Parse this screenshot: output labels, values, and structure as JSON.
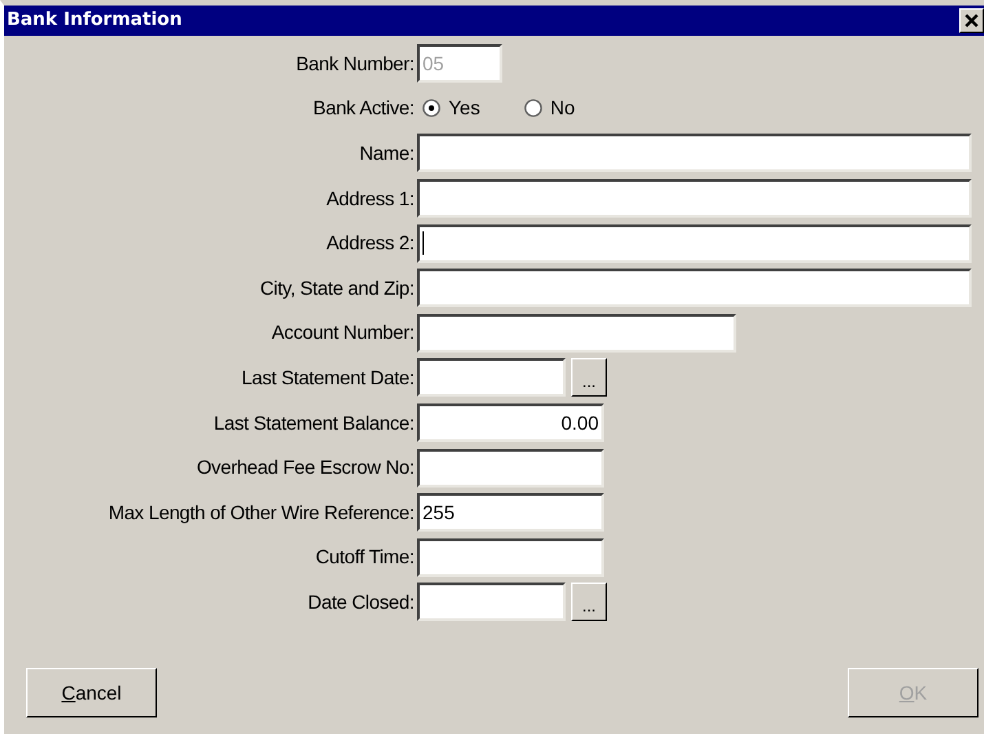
{
  "window": {
    "title": "Bank Information"
  },
  "fields": [
    {
      "kind": "tinytext",
      "label": "Bank Number:",
      "value": "05",
      "disabled": true
    },
    {
      "kind": "radio",
      "label": "Bank Active:",
      "options": [
        {
          "label": "Yes",
          "selected": true
        },
        {
          "label": "No",
          "selected": false
        }
      ]
    },
    {
      "kind": "longtext",
      "label": "Name:"
    },
    {
      "kind": "longtext",
      "label": "Address 1:"
    },
    {
      "kind": "longtext",
      "label": "Address 2:",
      "focused": true
    },
    {
      "kind": "longtext",
      "label": "City, State and Zip:"
    },
    {
      "kind": "mediumtext",
      "label": "Account Number:"
    },
    {
      "kind": "date",
      "label": "Last Statement Date:",
      "button": "..."
    },
    {
      "kind": "number",
      "label": "Last Statement Balance:",
      "value": "0.00"
    },
    {
      "kind": "shorttext",
      "label": "Overhead Fee Escrow No:"
    },
    {
      "kind": "shorttext",
      "label": "Max Length of Other Wire Reference:",
      "value": "255"
    },
    {
      "kind": "shorttext",
      "label": "Cutoff Time:"
    },
    {
      "kind": "date",
      "label": "Date Closed:",
      "button": "..."
    }
  ],
  "buttons": [
    {
      "label": "Cancel",
      "disabled": false
    },
    {
      "label": "OK",
      "disabled": true
    }
  ]
}
